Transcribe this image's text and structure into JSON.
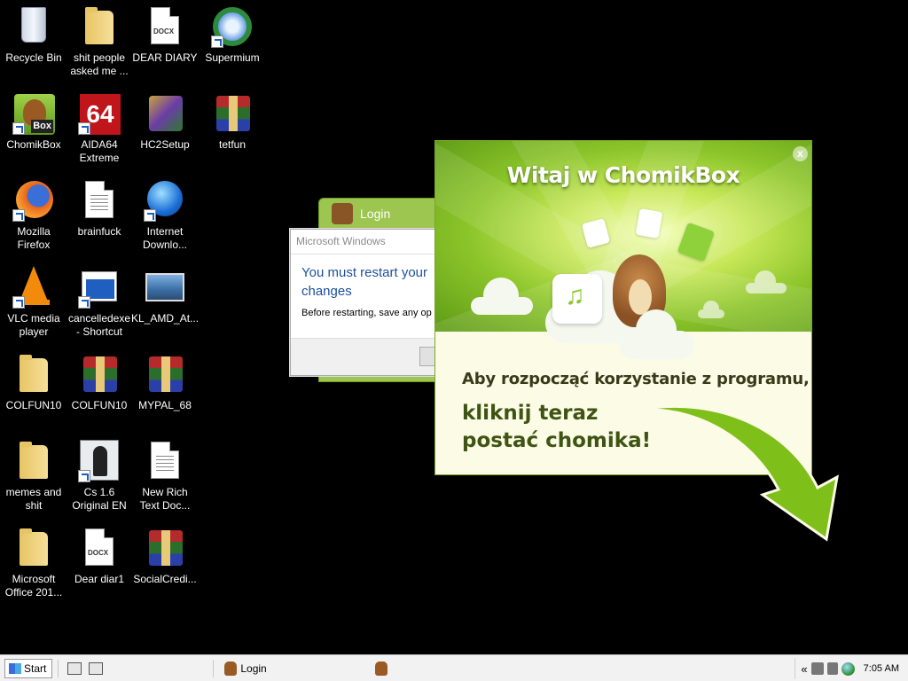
{
  "desktop": {
    "icons": [
      {
        "id": "recycle-bin",
        "label": "Recycle Bin",
        "icon": "recycle-bin-icon"
      },
      {
        "id": "folder-1",
        "label": "shit people asked me ...",
        "icon": "folder-icon"
      },
      {
        "id": "dear-diary",
        "label": "DEAR DIARY",
        "icon": "docx-icon",
        "tag": "DOCX"
      },
      {
        "id": "supermium",
        "label": "Supermium",
        "icon": "browser-icon"
      },
      {
        "id": "chomikbox",
        "label": "ChomikBox",
        "icon": "chomikbox-icon"
      },
      {
        "id": "aida64",
        "label": "AIDA64 Extreme",
        "icon": "aida64-icon",
        "tag": "64"
      },
      {
        "id": "hc2setup",
        "label": "HC2Setup",
        "icon": "setup-icon"
      },
      {
        "id": "tetfun",
        "label": "tetfun",
        "icon": "winrar-icon"
      },
      {
        "id": "firefox",
        "label": "Mozilla Firefox",
        "icon": "firefox-icon"
      },
      {
        "id": "brainfuck",
        "label": "brainfuck",
        "icon": "text-file-icon"
      },
      {
        "id": "idm",
        "label": "Internet Downlo...",
        "icon": "globe-download-icon"
      },
      {
        "id": "vlc",
        "label": "VLC media player",
        "icon": "vlc-icon"
      },
      {
        "id": "cancelledexe",
        "label": "cancelledexe - Shortcut",
        "icon": "exe-icon"
      },
      {
        "id": "kl-amd",
        "label": "KL_AMD_At...",
        "icon": "image-icon"
      },
      {
        "id": "colfun10-folder",
        "label": "COLFUN10",
        "icon": "folder-icon"
      },
      {
        "id": "colfun10-rar",
        "label": "COLFUN10",
        "icon": "winrar-icon"
      },
      {
        "id": "mypal",
        "label": "MYPAL_68",
        "icon": "winrar-icon"
      },
      {
        "id": "memes",
        "label": "memes and shit",
        "icon": "folder-icon"
      },
      {
        "id": "cs16",
        "label": "Cs 1.6 Original EN",
        "icon": "counter-strike-icon"
      },
      {
        "id": "new-rich-text",
        "label": "New Rich Text Doc...",
        "icon": "rtf-icon"
      },
      {
        "id": "office",
        "label": "Microsoft Office 201...",
        "icon": "folder-icon"
      },
      {
        "id": "dear-diar1",
        "label": "Dear diar1",
        "icon": "docx-icon",
        "tag": "DOCX"
      },
      {
        "id": "socialcredit",
        "label": "SocialCredi...",
        "icon": "winrar-icon"
      }
    ]
  },
  "login_window": {
    "title": "Login"
  },
  "ms_dialog": {
    "title": "Microsoft Windows",
    "main_text_1": "You must restart your",
    "main_text_2": "changes",
    "sub_text": "Before restarting, save any op"
  },
  "chomikbox_popup": {
    "title": "Witaj w ChomikBox",
    "close_label": "x",
    "line1": "Aby rozpocząć korzystanie z programu,",
    "line2a": "kliknij teraz",
    "line2b": "postać chomika!",
    "colors": {
      "green_dark": "#5d9a16",
      "green_light": "#c9e85a",
      "text_dark": "#3f5412"
    }
  },
  "taskbar": {
    "start_label": "Start",
    "tasks": [
      {
        "label": "Login",
        "icon": "chomikbox-icon"
      },
      {
        "label": "",
        "icon": "chomikbox-icon"
      }
    ],
    "tray_expand": "«",
    "clock": "7:05 AM"
  }
}
